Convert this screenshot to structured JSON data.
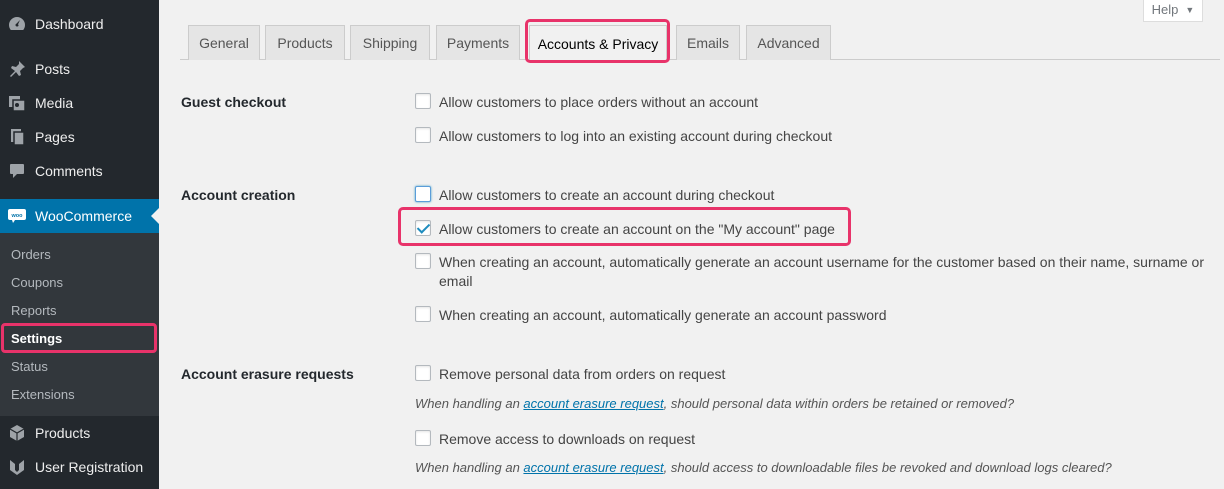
{
  "sidebar": {
    "menu": [
      {
        "label": "Dashboard",
        "icon": "dashboard-icon"
      },
      {
        "label": "Posts",
        "icon": "pin-icon"
      },
      {
        "label": "Media",
        "icon": "media-icon"
      },
      {
        "label": "Pages",
        "icon": "pages-icon"
      },
      {
        "label": "Comments",
        "icon": "comments-icon"
      },
      {
        "label": "WooCommerce",
        "icon": "woocommerce-icon"
      },
      {
        "label": "Products",
        "icon": "products-icon"
      },
      {
        "label": "User Registration",
        "icon": "user-registration-icon"
      }
    ],
    "submenu": [
      "Orders",
      "Coupons",
      "Reports",
      "Settings",
      "Status",
      "Extensions"
    ],
    "current_submenu": "Settings"
  },
  "help": {
    "label": "Help"
  },
  "tabs": [
    "General",
    "Products",
    "Shipping",
    "Payments",
    "Accounts & Privacy",
    "Emails",
    "Advanced"
  ],
  "active_tab": "Accounts & Privacy",
  "colors": {
    "highlight": "#e8336a",
    "accent": "#0073aa",
    "sidebar": "#23282d"
  },
  "sections": {
    "guest_checkout": {
      "label": "Guest checkout",
      "options": [
        {
          "text": "Allow customers to place orders without an account",
          "checked": false
        },
        {
          "text": "Allow customers to log into an existing account during checkout",
          "checked": false
        }
      ]
    },
    "account_creation": {
      "label": "Account creation",
      "options": [
        {
          "text": "Allow customers to create an account during checkout",
          "checked": false
        },
        {
          "text": "Allow customers to create an account on the \"My account\" page",
          "checked": true
        },
        {
          "text": "When creating an account, automatically generate an account username for the customer based on their name, surname or email",
          "checked": false
        },
        {
          "text": "When creating an account, automatically generate an account password",
          "checked": false
        }
      ]
    },
    "erasure": {
      "label": "Account erasure requests",
      "options": [
        {
          "text": "Remove personal data from orders on request",
          "checked": false
        },
        {
          "text": "Remove access to downloads on request",
          "checked": false
        }
      ],
      "desc1": {
        "prefix": "When handling an ",
        "link": "account erasure request",
        "suffix": ", should personal data within orders be retained or removed?"
      },
      "desc2": {
        "prefix": "When handling an ",
        "link": "account erasure request",
        "suffix": ", should access to downloadable files be revoked and download logs cleared?"
      }
    }
  }
}
